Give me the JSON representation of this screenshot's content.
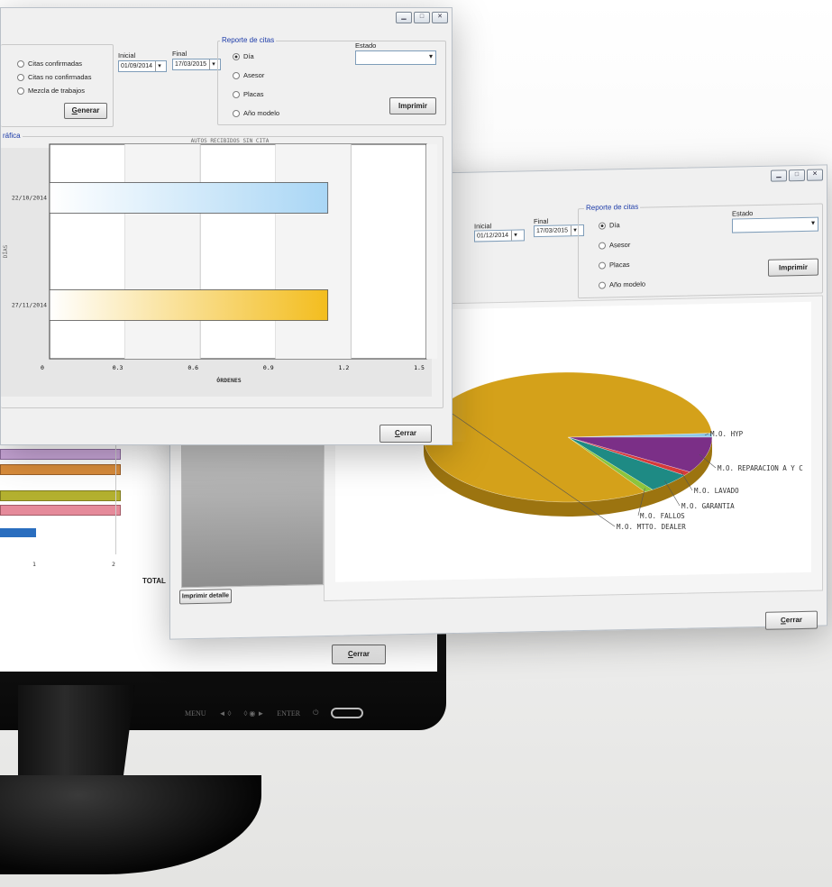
{
  "window_front": {
    "radios_left": [
      "Citas confirmadas",
      "Citas no confirmadas",
      "Mezcla de trabajos"
    ],
    "generar_label": "Generar",
    "inicial_label": "Inicial",
    "inicial_value": "01/09/2014",
    "final_label": "Final",
    "final_value": "17/03/2015",
    "reporte_legend": "Reporte de citas",
    "reporte_options": [
      "Día",
      "Asesor",
      "Placas",
      "Año modelo"
    ],
    "estado_label": "Estado",
    "imprimir_label": "Imprimir",
    "grafica_legend": "ráfica",
    "chart_title": "AUTOS RECIBIDOS SIN CITA",
    "cerrar_label": "Cerrar"
  },
  "window_back": {
    "inicial_label": "Inicial",
    "inicial_value": "01/12/2014",
    "final_label": "Final",
    "final_value": "17/03/2015",
    "reporte_legend": "Reporte de citas",
    "reporte_options": [
      "Día",
      "Asesor",
      "Placas",
      "Año modelo"
    ],
    "estado_label": "Estado",
    "imprimir_label": "Imprimir",
    "imprimir_detalle_label": "Imprimir detalle",
    "cerrar_label": "Cerrar"
  },
  "monitor": {
    "total_label": "TOTAL",
    "cerrar_label": "Cerrar",
    "axis_ticks": [
      "1",
      "2"
    ],
    "buttons": [
      "MENU",
      "◄ ◊",
      "◊ ◉ ►",
      "ENTER",
      "⏻"
    ]
  },
  "chart_data": [
    {
      "type": "bar",
      "orientation": "horizontal",
      "title": "AUTOS RECIBIDOS SIN CITA",
      "xlabel": "ÓRDENES",
      "ylabel": "DÍAS",
      "categories": [
        "22/10/2014",
        "27/11/2014"
      ],
      "values": [
        1,
        1
      ],
      "colors": [
        "#a9d6f5",
        "#f3bd1e"
      ],
      "xlim": [
        0,
        1.5
      ],
      "xticks": [
        "0",
        "0.3",
        "0.6",
        "0.9",
        "1.2",
        "1.5"
      ],
      "grid": true
    },
    {
      "type": "pie",
      "labels": [
        "M.O. HYP",
        "M.O. REPARACION A Y C",
        "M.O. LAVADO",
        "M.O. GARANTIA",
        "M.O. FALLOS",
        "M.O. MTTO. DEALER"
      ],
      "values": [
        1,
        9,
        1,
        5,
        1,
        83
      ],
      "colors": [
        "#8ec7e8",
        "#7b2f87",
        "#d63a3a",
        "#1e8a84",
        "#8cc43c",
        "#d4a11a"
      ]
    }
  ]
}
